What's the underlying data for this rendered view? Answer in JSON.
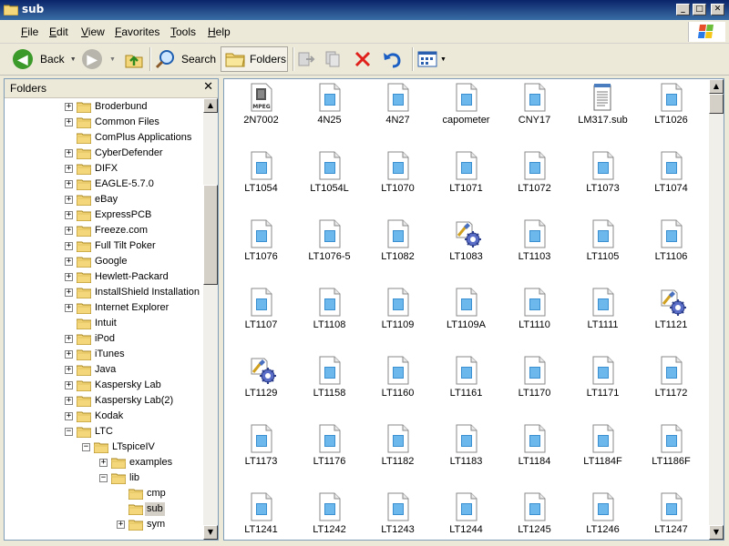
{
  "window": {
    "title": "sub"
  },
  "menu": [
    "File",
    "Edit",
    "View",
    "Favorites",
    "Tools",
    "Help"
  ],
  "toolbar": {
    "back": "Back",
    "search": "Search",
    "folders": "Folders"
  },
  "folders_pane": {
    "title": "Folders",
    "close": "✕",
    "items": [
      {
        "label": "Broderbund",
        "level": 0,
        "exp": "+"
      },
      {
        "label": "Common Files",
        "level": 0,
        "exp": "+"
      },
      {
        "label": "ComPlus Applications",
        "level": 0,
        "exp": ""
      },
      {
        "label": "CyberDefender",
        "level": 0,
        "exp": "+"
      },
      {
        "label": "DIFX",
        "level": 0,
        "exp": "+"
      },
      {
        "label": "EAGLE-5.7.0",
        "level": 0,
        "exp": "+"
      },
      {
        "label": "eBay",
        "level": 0,
        "exp": "+"
      },
      {
        "label": "ExpressPCB",
        "level": 0,
        "exp": "+"
      },
      {
        "label": "Freeze.com",
        "level": 0,
        "exp": "+"
      },
      {
        "label": "Full Tilt Poker",
        "level": 0,
        "exp": "+"
      },
      {
        "label": "Google",
        "level": 0,
        "exp": "+"
      },
      {
        "label": "Hewlett-Packard",
        "level": 0,
        "exp": "+"
      },
      {
        "label": "InstallShield Installation Information",
        "level": 0,
        "exp": "+"
      },
      {
        "label": "Internet Explorer",
        "level": 0,
        "exp": "+"
      },
      {
        "label": "Intuit",
        "level": 0,
        "exp": ""
      },
      {
        "label": "iPod",
        "level": 0,
        "exp": "+"
      },
      {
        "label": "iTunes",
        "level": 0,
        "exp": "+"
      },
      {
        "label": "Java",
        "level": 0,
        "exp": "+"
      },
      {
        "label": "Kaspersky Lab",
        "level": 0,
        "exp": "+"
      },
      {
        "label": "Kaspersky Lab(2)",
        "level": 0,
        "exp": "+"
      },
      {
        "label": "Kodak",
        "level": 0,
        "exp": "+"
      },
      {
        "label": "LTC",
        "level": 0,
        "exp": "−"
      },
      {
        "label": "LTspiceIV",
        "level": 1,
        "exp": "−"
      },
      {
        "label": "examples",
        "level": 2,
        "exp": "+"
      },
      {
        "label": "lib",
        "level": 2,
        "exp": "−"
      },
      {
        "label": "cmp",
        "level": 3,
        "exp": ""
      },
      {
        "label": "sub",
        "level": 3,
        "exp": "",
        "selected": true
      },
      {
        "label": "sym",
        "level": 3,
        "exp": "+"
      }
    ]
  },
  "files": [
    {
      "name": "2N7002",
      "icon": "mpeg"
    },
    {
      "name": "4N25",
      "icon": "doc"
    },
    {
      "name": "4N27",
      "icon": "doc"
    },
    {
      "name": "capometer",
      "icon": "doc"
    },
    {
      "name": "CNY17",
      "icon": "doc"
    },
    {
      "name": "LM317.sub",
      "icon": "notepad"
    },
    {
      "name": "LT1026",
      "icon": "doc"
    },
    {
      "name": "LT1054",
      "icon": "doc"
    },
    {
      "name": "LT1054L",
      "icon": "doc"
    },
    {
      "name": "LT1070",
      "icon": "doc"
    },
    {
      "name": "LT1071",
      "icon": "doc"
    },
    {
      "name": "LT1072",
      "icon": "doc"
    },
    {
      "name": "LT1073",
      "icon": "doc"
    },
    {
      "name": "LT1074",
      "icon": "doc"
    },
    {
      "name": "LT1076",
      "icon": "doc"
    },
    {
      "name": "LT1076-5",
      "icon": "doc"
    },
    {
      "name": "LT1082",
      "icon": "doc"
    },
    {
      "name": "LT1083",
      "icon": "gear"
    },
    {
      "name": "LT1103",
      "icon": "doc"
    },
    {
      "name": "LT1105",
      "icon": "doc"
    },
    {
      "name": "LT1106",
      "icon": "doc"
    },
    {
      "name": "LT1107",
      "icon": "doc"
    },
    {
      "name": "LT1108",
      "icon": "doc"
    },
    {
      "name": "LT1109",
      "icon": "doc"
    },
    {
      "name": "LT1109A",
      "icon": "doc"
    },
    {
      "name": "LT1110",
      "icon": "doc"
    },
    {
      "name": "LT1111",
      "icon": "doc"
    },
    {
      "name": "LT1121",
      "icon": "gear"
    },
    {
      "name": "LT1129",
      "icon": "gear"
    },
    {
      "name": "LT1158",
      "icon": "doc"
    },
    {
      "name": "LT1160",
      "icon": "doc"
    },
    {
      "name": "LT1161",
      "icon": "doc"
    },
    {
      "name": "LT1170",
      "icon": "doc"
    },
    {
      "name": "LT1171",
      "icon": "doc"
    },
    {
      "name": "LT1172",
      "icon": "doc"
    },
    {
      "name": "LT1173",
      "icon": "doc"
    },
    {
      "name": "LT1176",
      "icon": "doc"
    },
    {
      "name": "LT1182",
      "icon": "doc"
    },
    {
      "name": "LT1183",
      "icon": "doc"
    },
    {
      "name": "LT1184",
      "icon": "doc"
    },
    {
      "name": "LT1184F",
      "icon": "doc"
    },
    {
      "name": "LT1186F",
      "icon": "doc"
    },
    {
      "name": "LT1241",
      "icon": "doc"
    },
    {
      "name": "LT1242",
      "icon": "doc"
    },
    {
      "name": "LT1243",
      "icon": "doc"
    },
    {
      "name": "LT1244",
      "icon": "doc"
    },
    {
      "name": "LT1245",
      "icon": "doc"
    },
    {
      "name": "LT1246",
      "icon": "doc"
    },
    {
      "name": "LT1247",
      "icon": "doc"
    }
  ]
}
